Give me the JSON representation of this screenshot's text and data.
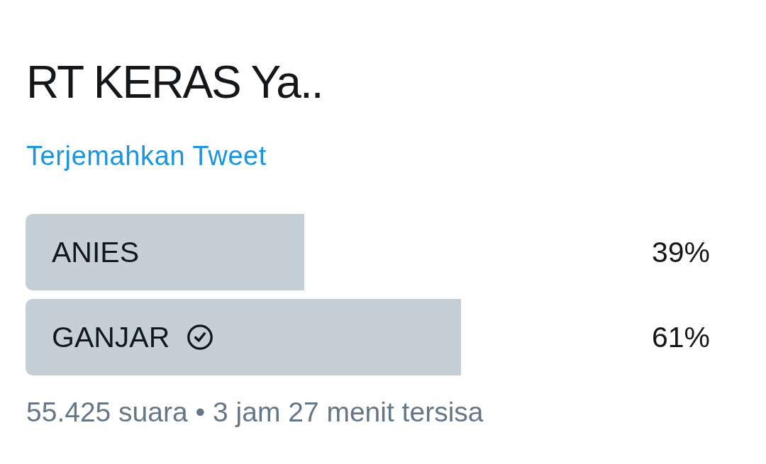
{
  "tweet": {
    "text": "RT KERAS Ya..",
    "translate_link": "Terjemahkan Tweet"
  },
  "poll": {
    "options": [
      {
        "label": "ANIES",
        "percent": "39%",
        "level": 0.39,
        "voted": false
      },
      {
        "label": "GANJAR",
        "percent": "61%",
        "level": 0.61,
        "voted": true
      }
    ],
    "footer": "55.425 suara • 3 jam 27 menit tersisa"
  }
}
